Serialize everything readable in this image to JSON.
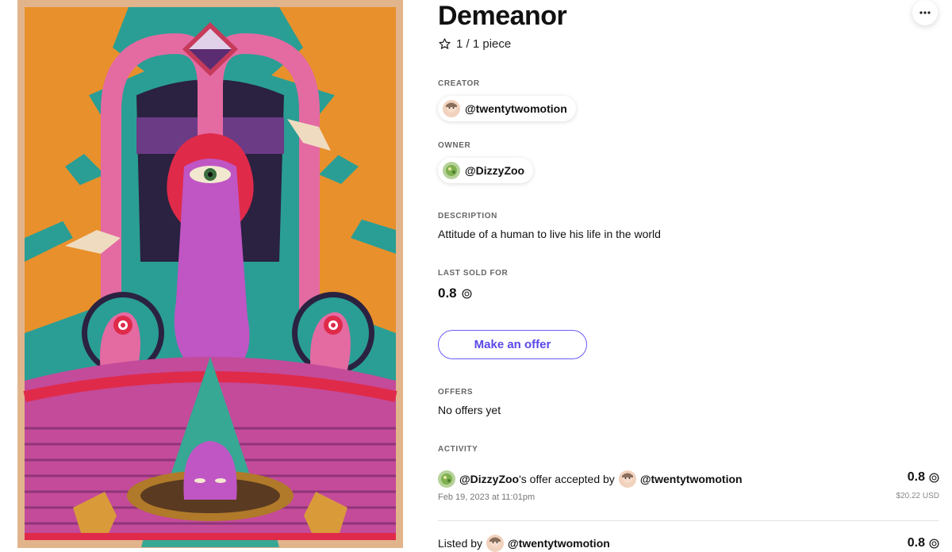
{
  "artwork": {
    "alt": "Demeanor artwork"
  },
  "title": "Demeanor",
  "edition": "1 / 1 piece",
  "creator": {
    "label": "CREATOR",
    "handle": "@twentytwomotion"
  },
  "owner": {
    "label": "OWNER",
    "handle": "@DizzyZoo"
  },
  "description": {
    "label": "DESCRIPTION",
    "text": "Attitude of a human to live his life in the world"
  },
  "last_sold": {
    "label": "LAST SOLD FOR",
    "price": "0.8"
  },
  "make_offer_label": "Make an offer",
  "offers": {
    "label": "OFFERS",
    "text": "No offers yet"
  },
  "activity": {
    "label": "ACTIVITY",
    "items": [
      {
        "actor": "@DizzyZoo",
        "middle": "'s offer accepted by",
        "target": "@twentytwomotion",
        "date": "Feb 19, 2023 at 11:01pm",
        "price": "0.8",
        "usd": "$20.22 USD"
      },
      {
        "prefix": "Listed by",
        "target": "@twentytwomotion",
        "price": "0.8"
      }
    ]
  },
  "colors": {
    "accent": "#6b5cf5",
    "teal": "#2a9e94",
    "orange": "#e8902c",
    "magenta": "#d84d94"
  }
}
